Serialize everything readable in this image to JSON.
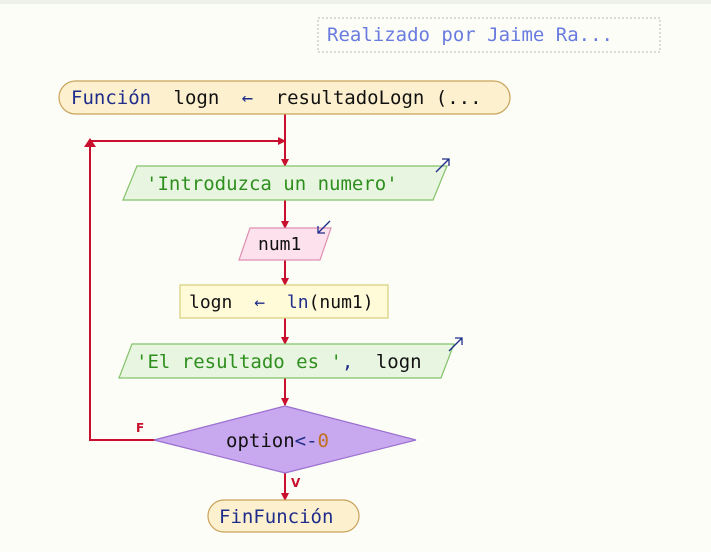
{
  "credit": "Realizado por Jaime Ra...",
  "function_header": {
    "keyword": "Función",
    "name": "logn",
    "arrow": "←",
    "call": "resultadoLogn (..."
  },
  "output_1": "'Introduzca un numero'",
  "input_var": "num1",
  "assignment": {
    "target": "logn",
    "arrow": "←",
    "func": "ln",
    "open": "(",
    "arg": "num1",
    "close": ")"
  },
  "output_2": {
    "literal": "'El resultado es '",
    "sep": ",",
    "var": "logn"
  },
  "decision": {
    "prefix": "option",
    "op": "<-",
    "value": "0"
  },
  "label_false": "F",
  "label_true": "V",
  "end": "FinFunción",
  "colors": {
    "flow_line": "#c8102e",
    "terminal_fill": "#fdf0cf",
    "terminal_stroke": "#c9a25a",
    "io_fill": "#e8f6e1",
    "io_stroke": "#84c26a",
    "input_fill": "#fde1ec",
    "input_stroke": "#df8fb0",
    "process_fill": "#fffbd8",
    "process_stroke": "#d8cf7a",
    "decision_fill": "#c8a8ef",
    "decision_stroke": "#9a6fd0",
    "keyword": "#1f2d8a",
    "string": "#2f8f1e",
    "number": "#c0701e",
    "credit": "#6a7be0"
  }
}
